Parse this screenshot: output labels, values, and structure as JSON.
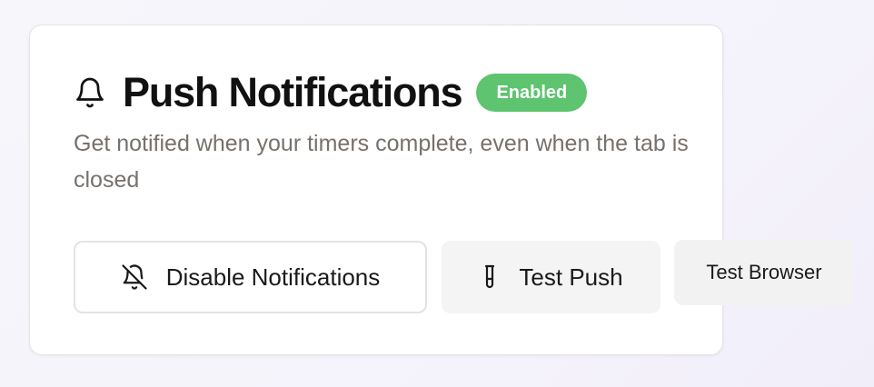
{
  "card": {
    "icon": "bell-icon",
    "title": "Push Notifications",
    "status_badge": "Enabled",
    "description": "Get notified when your timers complete, even when the tab is closed"
  },
  "actions": {
    "disable": {
      "label": "Disable Notifications",
      "icon": "bell-off-icon"
    },
    "test_push": {
      "label": "Test Push",
      "icon": "test-tube-icon"
    },
    "test_browser": {
      "label": "Test Browser"
    }
  },
  "colors": {
    "badge_bg": "#5ec46f",
    "title": "#111111",
    "description": "#77716c",
    "secondary_button_bg": "#f4f4f4"
  }
}
